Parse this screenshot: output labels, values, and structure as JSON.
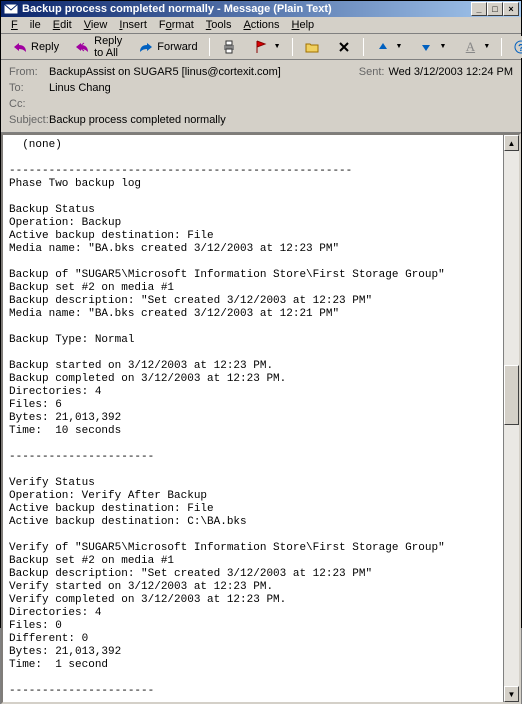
{
  "title": "Backup process completed normally - Message (Plain Text)",
  "menu": {
    "file": "File",
    "edit": "Edit",
    "view": "View",
    "insert": "Insert",
    "format": "Format",
    "tools": "Tools",
    "actions": "Actions",
    "help": "Help"
  },
  "toolbar": {
    "reply": "Reply",
    "reply_all": "Reply to All",
    "forward": "Forward"
  },
  "headers": {
    "from_label": "From:",
    "from_value": "BackupAssist on SUGAR5 [linus@cortexit.com]",
    "to_label": "To:",
    "to_value": "Linus Chang",
    "cc_label": "Cc:",
    "cc_value": "",
    "subject_label": "Subject:",
    "subject_value": "Backup process completed normally",
    "sent_label": "Sent:",
    "sent_value": "Wed 3/12/2003 12:24 PM"
  },
  "body": "  (none)\n\n----------------------------------------------------\nPhase Two backup log\n\nBackup Status\nOperation: Backup\nActive backup destination: File\nMedia name: \"BA.bks created 3/12/2003 at 12:23 PM\"\n\nBackup of \"SUGAR5\\Microsoft Information Store\\First Storage Group\"\nBackup set #2 on media #1\nBackup description: \"Set created 3/12/2003 at 12:23 PM\"\nMedia name: \"BA.bks created 3/12/2003 at 12:21 PM\"\n\nBackup Type: Normal\n\nBackup started on 3/12/2003 at 12:23 PM.\nBackup completed on 3/12/2003 at 12:23 PM.\nDirectories: 4\nFiles: 6\nBytes: 21,013,392\nTime:  10 seconds\n\n----------------------\n\nVerify Status\nOperation: Verify After Backup\nActive backup destination: File\nActive backup destination: C:\\BA.bks\n\nVerify of \"SUGAR5\\Microsoft Information Store\\First Storage Group\"\nBackup set #2 on media #1\nBackup description: \"Set created 3/12/2003 at 12:23 PM\"\nVerify started on 3/12/2003 at 12:23 PM.\nVerify completed on 3/12/2003 at 12:23 PM.\nDirectories: 4\nFiles: 0\nDifferent: 0\nBytes: 21,013,392\nTime:  1 second\n\n----------------------"
}
